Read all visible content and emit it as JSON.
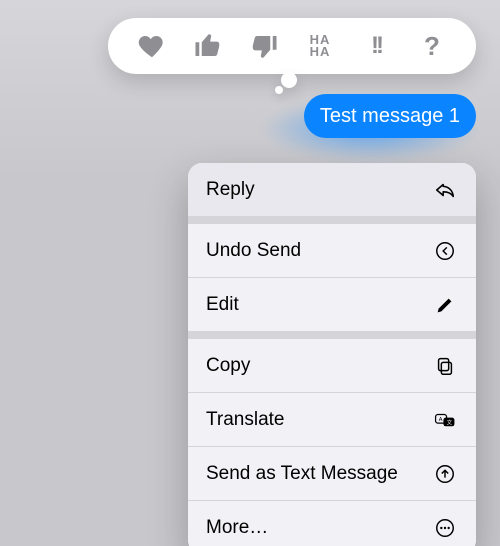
{
  "message": {
    "text": "Test message 1"
  },
  "tapbacks": {
    "heart": "heart",
    "thumbs_up": "thumbs-up",
    "thumbs_down": "thumbs-down",
    "haha": "HA HA",
    "emphasis": "!!",
    "question": "?"
  },
  "menu": {
    "reply": "Reply",
    "undo_send": "Undo Send",
    "edit": "Edit",
    "copy": "Copy",
    "translate": "Translate",
    "send_as_text": "Send as Text Message",
    "more": "More…"
  }
}
